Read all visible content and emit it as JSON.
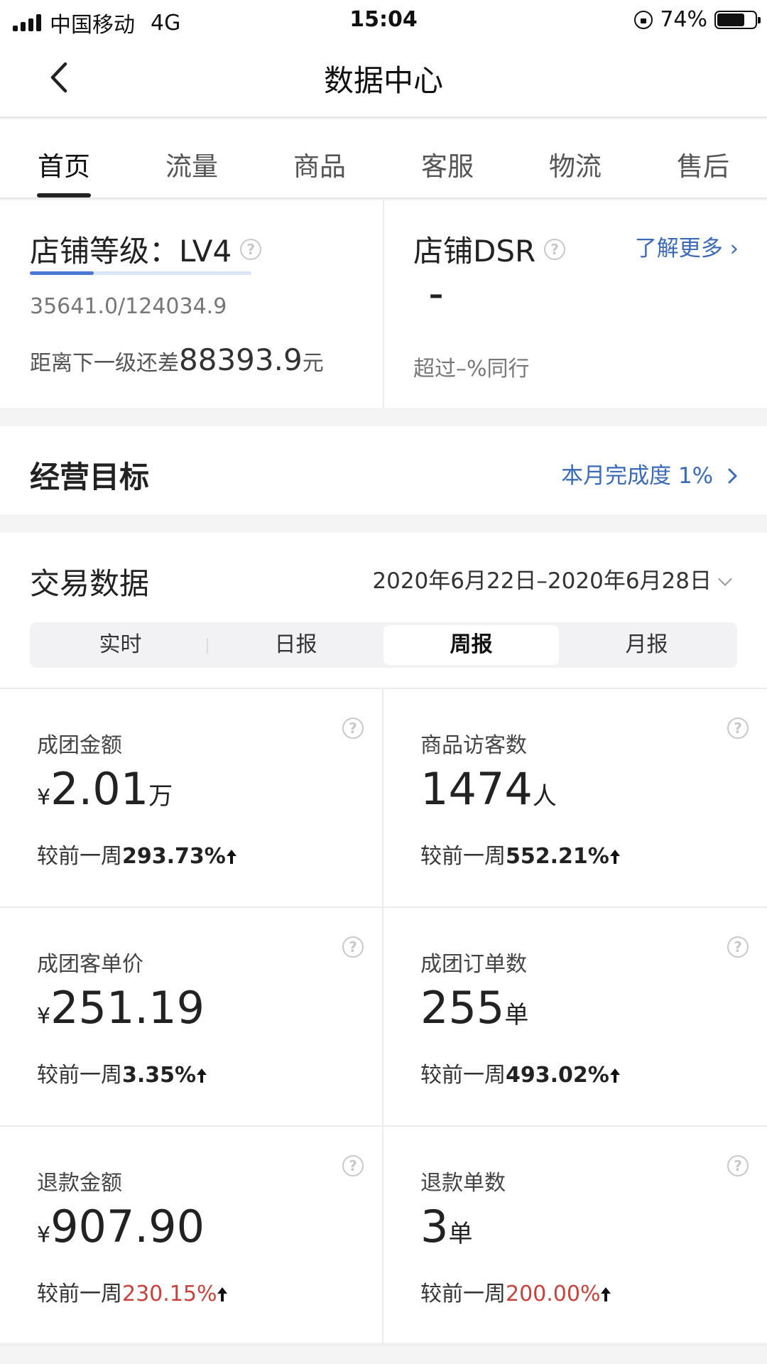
{
  "status_bar": {
    "carrier": "中国移动",
    "network": "4G",
    "time": "15:04",
    "battery": "74%",
    "battery_level": 74
  },
  "nav": {
    "title": "数据中心",
    "back_icon": "chevron-left-icon"
  },
  "tabs": [
    {
      "label": "首页",
      "active": true
    },
    {
      "label": "流量",
      "active": false
    },
    {
      "label": "商品",
      "active": false
    },
    {
      "label": "客服",
      "active": false
    },
    {
      "label": "物流",
      "active": false
    },
    {
      "label": "售后",
      "active": false
    }
  ],
  "shop_level": {
    "title": "店铺等级：LV4",
    "score": "35641.0/124034.9",
    "progress": 0.287,
    "gap_prefix": "距离下一级还差",
    "gap_value": "88393.9",
    "gap_unit": "元"
  },
  "shop_dsr": {
    "title": "店铺DSR",
    "learn_more": "了解更多 ›",
    "value": "–",
    "exceed": "超过–%同行"
  },
  "goal": {
    "title": "经营目标",
    "progress_link": "本月完成度 1%"
  },
  "trade": {
    "title": "交易数据",
    "date_range": "2020年6月22日–2020年6月28日",
    "segments": [
      {
        "label": "实时",
        "active": false
      },
      {
        "label": "日报",
        "active": false
      },
      {
        "label": "周报",
        "active": true
      },
      {
        "label": "月报",
        "active": false
      }
    ],
    "metrics": [
      {
        "label": "成团金额",
        "yen": "¥",
        "value": "2.01",
        "unit": "万",
        "cmp_prefix": "较前一周",
        "cmp": "293.73%",
        "red": false
      },
      {
        "label": "商品访客数",
        "yen": "",
        "value": "1474",
        "unit": "人",
        "cmp_prefix": "较前一周",
        "cmp": "552.21%",
        "red": false
      },
      {
        "label": "成团客单价",
        "yen": "¥",
        "value": "251.19",
        "unit": "",
        "cmp_prefix": "较前一周",
        "cmp": "3.35%",
        "red": false
      },
      {
        "label": "成团订单数",
        "yen": "",
        "value": "255",
        "unit": "单",
        "cmp_prefix": "较前一周",
        "cmp": "493.02%",
        "red": false
      },
      {
        "label": "退款金额",
        "yen": "¥",
        "value": "907.90",
        "unit": "",
        "cmp_prefix": "较前一周",
        "cmp": "230.15%",
        "red": true
      },
      {
        "label": "退款单数",
        "yen": "",
        "value": "3",
        "unit": "单",
        "cmp_prefix": "较前一周",
        "cmp": "200.00%",
        "red": true
      }
    ]
  },
  "colors": {
    "accent_link": "#3b6bb8",
    "progress": "#4a78d4",
    "negative": "#c9423b"
  }
}
